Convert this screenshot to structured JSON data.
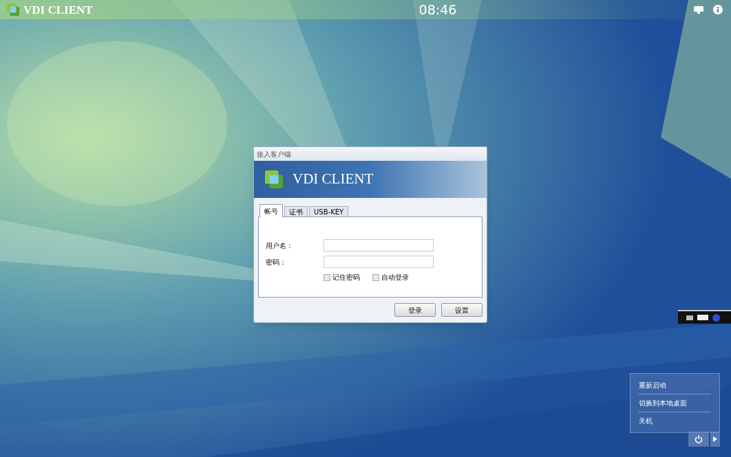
{
  "top_bar": {
    "logo_text": "VDI CLIENT",
    "clock": "08:46"
  },
  "dialog": {
    "title": "接入客户端",
    "banner_text": "VDI CLIENT",
    "tabs": [
      {
        "label": "帐号",
        "selected": true
      },
      {
        "label": "证书",
        "selected": false
      },
      {
        "label": "USB-KEY",
        "selected": false
      }
    ],
    "fields": [
      {
        "label": "用户名："
      },
      {
        "label": "密码："
      }
    ],
    "checkboxes": [
      {
        "label": "记住密码",
        "checked": false
      },
      {
        "label": "自动登录",
        "checked": false
      }
    ],
    "buttons": [
      "登录",
      "设置"
    ]
  },
  "power_menu": {
    "items": [
      "重新启动",
      "切换到本地桌面",
      "关机"
    ]
  }
}
